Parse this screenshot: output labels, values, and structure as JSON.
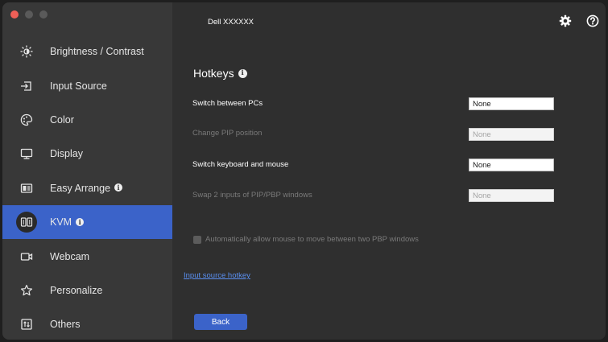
{
  "window": {
    "title": "Dell XXXXXX"
  },
  "sidebar": {
    "items": [
      {
        "label": "Brightness / Contrast",
        "icon": "brightness-icon",
        "active": false,
        "info": false
      },
      {
        "label": "Input Source",
        "icon": "input-source-icon",
        "active": false,
        "info": false
      },
      {
        "label": "Color",
        "icon": "color-palette-icon",
        "active": false,
        "info": false
      },
      {
        "label": "Display",
        "icon": "monitor-icon",
        "active": false,
        "info": false
      },
      {
        "label": "Easy Arrange",
        "icon": "easy-arrange-icon",
        "active": false,
        "info": true
      },
      {
        "label": "KVM",
        "icon": "kvm-icon",
        "active": true,
        "info": true
      },
      {
        "label": "Webcam",
        "icon": "webcam-icon",
        "active": false,
        "info": false
      },
      {
        "label": "Personalize",
        "icon": "star-icon",
        "active": false,
        "info": false
      },
      {
        "label": "Others",
        "icon": "others-icon",
        "active": false,
        "info": false
      }
    ]
  },
  "main": {
    "heading": "Hotkeys",
    "hotkeys": [
      {
        "label": "Switch between PCs",
        "value": "None",
        "enabled": true
      },
      {
        "label": "Change PIP position",
        "value": "None",
        "enabled": false
      },
      {
        "label": "Switch keyboard and mouse",
        "value": "None",
        "enabled": true
      },
      {
        "label": "Swap 2 inputs of PIP/PBP windows",
        "value": "None",
        "enabled": false
      }
    ],
    "checkbox_label": "Automatically allow mouse to move between two PBP windows",
    "checkbox_checked": false,
    "link": "Input source hotkey",
    "back_label": "Back"
  },
  "colors": {
    "accent": "#3b63c9",
    "sidebar_bg": "#383838",
    "content_bg": "#2f2f2f",
    "link": "#5a8ff0"
  }
}
